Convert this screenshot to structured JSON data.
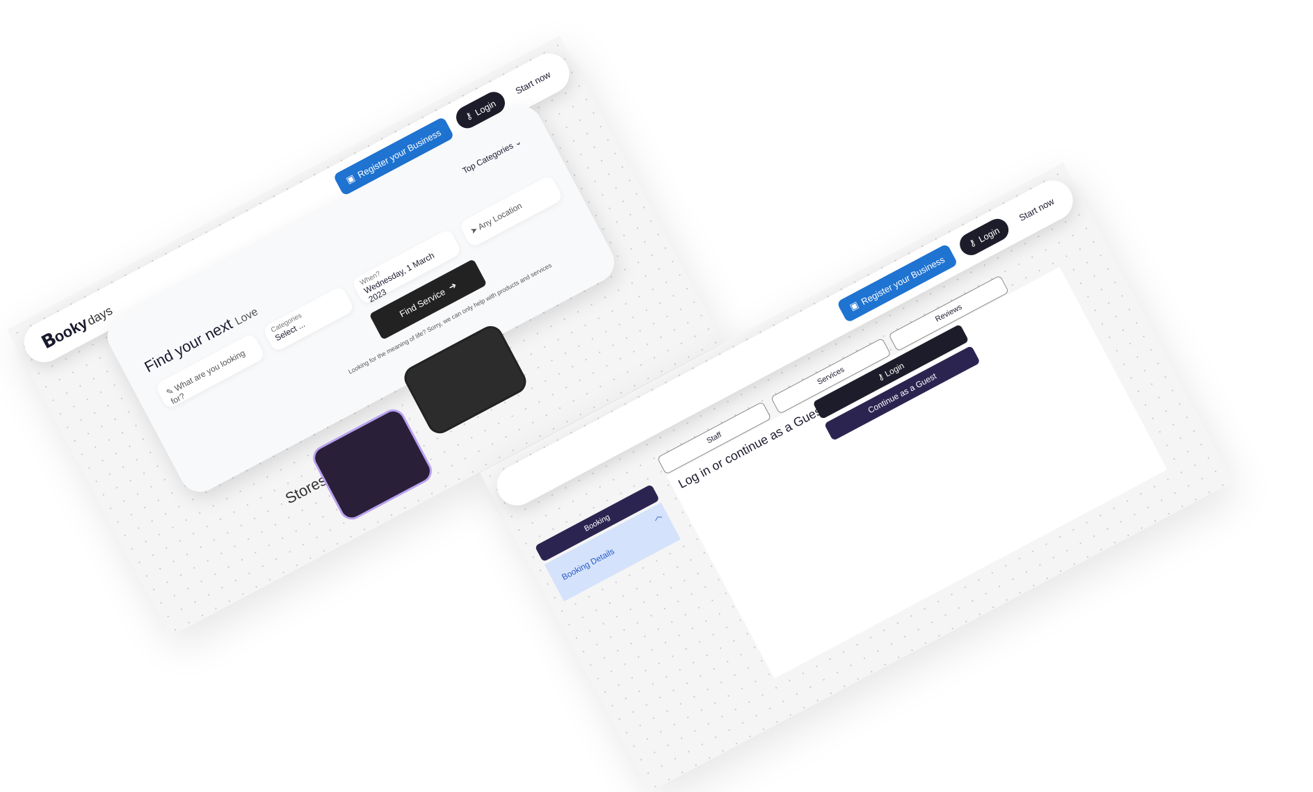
{
  "brand": {
    "logo_mark": "B",
    "logo_word": "ooky",
    "logo_suffix": "days"
  },
  "nav": {
    "register_label": "Register your Business",
    "login_label": "Login",
    "start_label": "Start now"
  },
  "search": {
    "title": "Find your next",
    "title_suffix": "Love",
    "what_placeholder": "What are you looking for?",
    "categories_label": "Categories",
    "categories_value": "Select ...",
    "when_label": "When?",
    "when_value": "Wednesday, 1 March 2023",
    "location_placeholder": "Any Location",
    "top_categories": "Top Categories",
    "find_button": "Find Service",
    "note": "Looking for the meaning of life? Sorry, we can only help with products and services"
  },
  "stores": {
    "title": "Stores."
  },
  "booking": {
    "tabs": [
      "Staff",
      "Services",
      "Reviews"
    ],
    "heading": "Log in or continue as a Guest",
    "login_button": "Login",
    "guest_button": "Continue as a Guest",
    "sidebar_booking": "Booking",
    "sidebar_details": "Booking Details"
  },
  "colors": {
    "accent_blue": "#1f73d1",
    "dark": "#1c1c2a",
    "purple": "#2c2450",
    "light_blue": "#d4e2fb"
  }
}
